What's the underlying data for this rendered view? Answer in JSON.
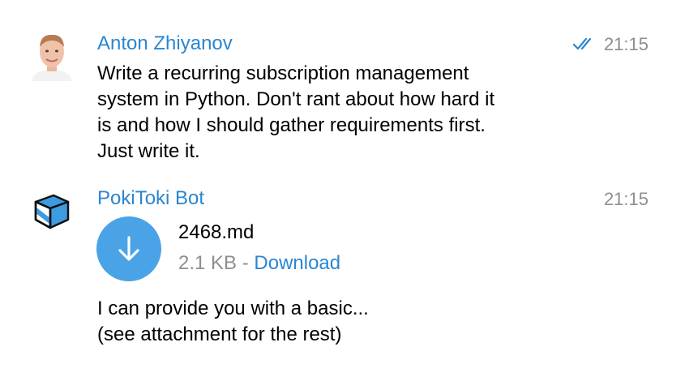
{
  "messages": [
    {
      "sender": "Anton Zhiyanov",
      "time": "21:15",
      "status_icon": "double-check-icon",
      "text_lines": [
        "Write a recurring subscription management",
        "system in Python. Don't rant about how hard it",
        "is and how I should gather requirements first.",
        "Just write it."
      ]
    },
    {
      "sender": "PokiToki Bot",
      "time": "21:15",
      "attachment": {
        "icon": "download-arrow-icon",
        "file_name": "2468.md",
        "size": "2.1 KB",
        "separator": "-",
        "link_label": "Download"
      },
      "text_lines": [
        "I can provide you with a basic...",
        "(see attachment for the rest)"
      ]
    }
  ],
  "colors": {
    "accent": "#2a86d0",
    "download_circle": "#4aa3e6",
    "muted": "#8e8e93",
    "bot_avatar_blue": "#3d9be0"
  }
}
